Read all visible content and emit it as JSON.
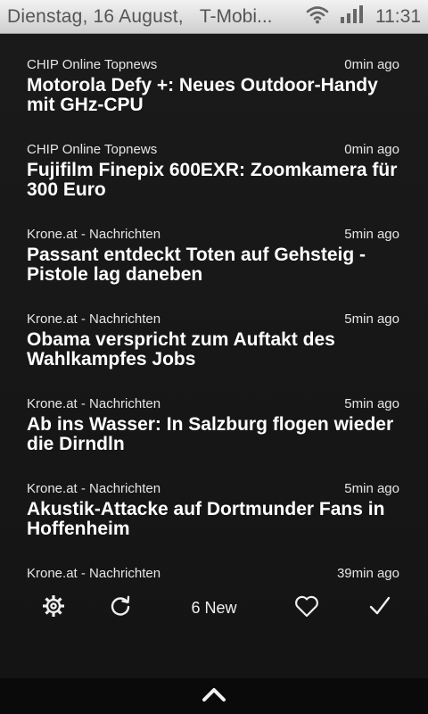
{
  "statusbar": {
    "date": "Dienstag, 16 August,",
    "carrier": "T-Mobi...",
    "time": "11:31",
    "wifi_icon": "wifi-icon",
    "signal_icon": "signal-icon"
  },
  "feed": {
    "items": [
      {
        "source": "CHIP Online Topnews",
        "age": "0min ago",
        "title": "Motorola Defy +: Neues Outdoor-Handy mit GHz-CPU"
      },
      {
        "source": "CHIP Online Topnews",
        "age": "0min ago",
        "title": "Fujifilm Finepix 600EXR: Zoomkamera für 300 Euro"
      },
      {
        "source": "Krone.at - Nachrichten",
        "age": "5min ago",
        "title": "Passant entdeckt Toten auf Gehsteig - Pistole lag daneben"
      },
      {
        "source": "Krone.at - Nachrichten",
        "age": "5min ago",
        "title": "Obama verspricht zum Auftakt des Wahlkampfes Jobs"
      },
      {
        "source": "Krone.at - Nachrichten",
        "age": "5min ago",
        "title": "Ab ins Wasser: In Salzburg flogen wieder die Dirndln"
      },
      {
        "source": "Krone.at - Nachrichten",
        "age": "5min ago",
        "title": "Akustik-Attacke auf Dortmunder Fans in Hoffenheim"
      },
      {
        "source": "Krone.at - Nachrichten",
        "age": "39min ago",
        "title": ""
      }
    ]
  },
  "toolbar": {
    "settings_icon": "gear-icon",
    "refresh_icon": "refresh-icon",
    "new_label": "6 New",
    "favorite_icon": "heart-icon",
    "mark_read_icon": "checkmark-icon"
  },
  "bottombar": {
    "handle_icon": "chevron-up-icon"
  }
}
